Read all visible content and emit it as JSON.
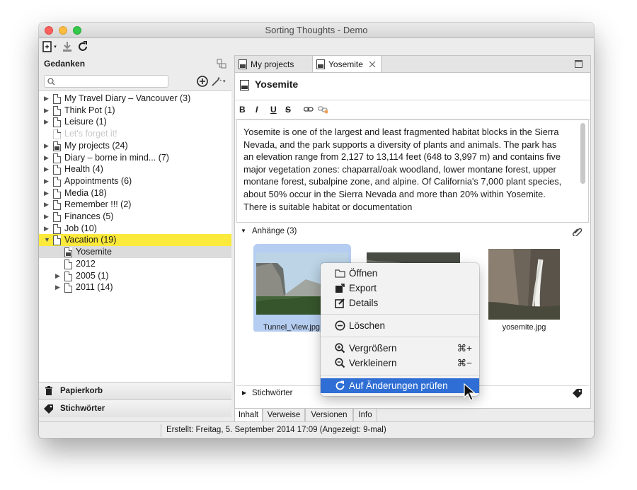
{
  "window": {
    "title": "Sorting Thoughts - Demo"
  },
  "left_pane": {
    "title": "Gedanken",
    "search": {
      "value": "",
      "placeholder": ""
    },
    "tree": [
      {
        "label": "My Travel Diary – Vancouver (3)",
        "level": 0,
        "expandable": true,
        "disabled": false
      },
      {
        "label": "Think Pot (1)",
        "level": 0,
        "expandable": true,
        "disabled": false
      },
      {
        "label": "Leisure (1)",
        "level": 0,
        "expandable": true,
        "disabled": false
      },
      {
        "label": "Let's forget it!",
        "level": 0,
        "expandable": false,
        "disabled": true
      },
      {
        "label": "My projects (24)",
        "level": 0,
        "expandable": true,
        "disabled": false,
        "image": true
      },
      {
        "label": "Diary – borne in mind... (7)",
        "level": 0,
        "expandable": true,
        "disabled": false
      },
      {
        "label": "Health (4)",
        "level": 0,
        "expandable": true,
        "disabled": false
      },
      {
        "label": "Appointments (6)",
        "level": 0,
        "expandable": true,
        "disabled": false
      },
      {
        "label": "Media (18)",
        "level": 0,
        "expandable": true,
        "disabled": false
      },
      {
        "label": "Remember !!! (2)",
        "level": 0,
        "expandable": true,
        "disabled": false
      },
      {
        "label": "Finances (5)",
        "level": 0,
        "expandable": true,
        "disabled": false
      },
      {
        "label": "Job (10)",
        "level": 0,
        "expandable": true,
        "disabled": false
      },
      {
        "label": "Vacation (19)",
        "level": 0,
        "expandable": true,
        "expanded": true,
        "selected": true
      },
      {
        "label": "Yosemite",
        "level": 1,
        "expandable": false,
        "image": true,
        "current": true
      },
      {
        "label": "2012",
        "level": 1,
        "expandable": false
      },
      {
        "label": "2005 (1)",
        "level": 1,
        "expandable": true
      },
      {
        "label": "2011 (14)",
        "level": 1,
        "expandable": true
      }
    ],
    "bottom": {
      "trash": "Papierkorb",
      "keywords": "Stichwörter"
    }
  },
  "tabs": [
    {
      "label": "My projects",
      "active": false
    },
    {
      "label": "Yosemite",
      "active": true,
      "closable": true
    }
  ],
  "editor": {
    "title": "Yosemite",
    "format_buttons": [
      "B",
      "I",
      "U",
      "S"
    ],
    "body": "Yosemite is one of the largest and least fragmented habitat blocks in the Sierra Nevada, and the park supports a diversity of plants and animals. The park has an elevation range from 2,127 to 13,114 feet (648 to 3,997 m) and contains five major vegetation zones: chaparral/oak woodland, lower montane forest, upper montane forest, subalpine zone, and alpine. Of California's 7,000 plant species, about 50% occur in the Sierra Nevada and more than 20% within Yosemite. There is suitable habitat or documentation"
  },
  "attachments": {
    "header": "Anhänge (3)",
    "items": [
      {
        "caption": "Tunnel_View.jpg",
        "selected": true
      },
      {
        "caption": "",
        "selected": false
      },
      {
        "caption": "yosemite.jpg",
        "selected": false
      }
    ]
  },
  "keywords_section": {
    "label": "Stichwörter"
  },
  "bottom_tabs": [
    {
      "label": "Inhalt",
      "active": true
    },
    {
      "label": "Verweise",
      "active": false
    },
    {
      "label": "Versionen",
      "active": false
    },
    {
      "label": "Info",
      "active": false
    }
  ],
  "status": "Erstellt: Freitag, 5. September 2014 17:09  (Angezeigt: 9-mal)",
  "context_menu": {
    "items": [
      {
        "label": "Öffnen",
        "icon": "folder-icon"
      },
      {
        "label": "Export",
        "icon": "export-icon"
      },
      {
        "label": "Details",
        "icon": "edit-icon"
      },
      {
        "label": "Löschen",
        "icon": "minus-circle-icon"
      },
      {
        "label": "Vergrößern",
        "icon": "zoom-in-icon",
        "shortcut": "⌘+"
      },
      {
        "label": "Verkleinern",
        "icon": "zoom-out-icon",
        "shortcut": "⌘−"
      },
      {
        "label": "Auf Änderungen prüfen",
        "icon": "refresh-icon",
        "highlighted": true
      }
    ]
  },
  "colors": {
    "selection_yellow": "#fbe93b",
    "menu_highlight": "#2f6ed4"
  }
}
